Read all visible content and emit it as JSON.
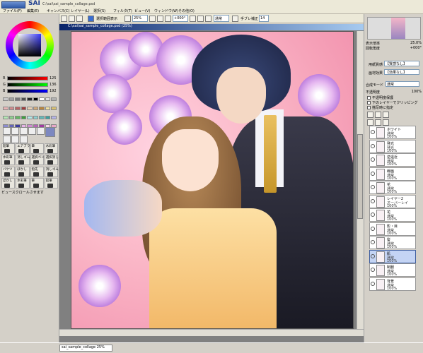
{
  "app": {
    "name": "SAI",
    "titlebar": "EasyPaint Tool SAI",
    "filename": "C:\\sai\\sai_sample_collage.psd"
  },
  "menu": [
    "ファイル(F)",
    "編集(E)",
    "キャンバス(C)",
    "レイヤー(L)",
    "選択(S)",
    "フィルタ(T)",
    "ビュー(V)",
    "ウィンドウ(W)",
    "その他(O)"
  ],
  "toolbar": {
    "show_selection": "選択範囲表示",
    "zoom": "25%",
    "rotation": "+000°",
    "blend": "通常",
    "stabilizer_label": "手ブレ補正",
    "stabilizer": "14"
  },
  "color": {
    "sliders": [
      {
        "label": "R",
        "value": "125"
      },
      {
        "label": "G",
        "value": "136"
      },
      {
        "label": "B",
        "value": "192"
      }
    ],
    "accent": "#7d88c0",
    "swatches": [
      "#c8c8c8",
      "#a0a0a0",
      "#787878",
      "#505050",
      "#282828",
      "#000000",
      "#ffffff",
      "#e0e0e0",
      "#b0b0b0",
      "#e8b4b4",
      "#d08c8c",
      "#b86464",
      "#a03c3c",
      "#e8d0b4",
      "#d0a878",
      "#b8843c",
      "#f0e0a0",
      "#d8c070",
      "#b4e8b4",
      "#8cd08c",
      "#64b864",
      "#3ca03c",
      "#b4e8e8",
      "#8cd0d0",
      "#64b8b8",
      "#3ca0a0",
      "#b4b4e8",
      "#8c8cd0",
      "#6464b8",
      "#3c3ca0",
      "#e8b4e8",
      "#d08cd0",
      "#b864b8",
      "#a03ca0",
      "#f8d8e8",
      "#e8a8c8"
    ]
  },
  "brushes": [
    {
      "label": "鉛筆"
    },
    {
      "label": "エアブラシ"
    },
    {
      "label": "筆"
    },
    {
      "label": "水彩筆"
    },
    {
      "label": "水彩筆"
    },
    {
      "label": "消しゴム"
    },
    {
      "label": "選択ペン"
    },
    {
      "label": "選択消し"
    },
    {
      "label": "バケツ"
    },
    {
      "label": "ぼかし"
    },
    {
      "label": "指先"
    },
    {
      "label": "消しゴム"
    },
    {
      "label": "ぼかし"
    },
    {
      "label": "水彩筆"
    },
    {
      "label": "筆"
    },
    {
      "label": "鉛筆"
    }
  ],
  "left_status": "ビュースクロールさせます",
  "canvas": {
    "title": "C:\\sai\\sai_sample_collage.psd (25%)"
  },
  "right": {
    "zoom_label": "表示倍率",
    "zoom_value": "25.0%",
    "angle_label": "回転角度",
    "angle_value": "+000°",
    "paper_texture_label": "用紙質感",
    "paper_texture": "【質感なし】",
    "paper_effect_label": "画材効果",
    "paper_effect": "【効果なし】",
    "blend_label": "合成モード",
    "blend": "通常",
    "opacity_label": "不透明度",
    "opacity": "100%",
    "checks": [
      "不透明度保護",
      "下のレイヤーでクリッピング",
      "描写時に指定"
    ],
    "layers": [
      {
        "name": "ホワイト",
        "mode": "通常",
        "opacity": "100%",
        "selected": false
      },
      {
        "name": "発光",
        "mode": "発光",
        "opacity": "100%",
        "selected": false
      },
      {
        "name": "逆遠近",
        "mode": "通常",
        "opacity": "100%",
        "selected": false
      },
      {
        "name": "線画",
        "mode": "通常",
        "opacity": "100%",
        "selected": false
      },
      {
        "name": "花",
        "mode": "通常",
        "opacity": "100%",
        "selected": false
      },
      {
        "name": "レイヤー2",
        "mode": "オーバーレイ",
        "opacity": "100%",
        "selected": false
      },
      {
        "name": "花",
        "mode": "通常",
        "opacity": "100%",
        "selected": false
      },
      {
        "name": "影・目",
        "mode": "通常",
        "opacity": "100%",
        "selected": false
      },
      {
        "name": "髪",
        "mode": "通常",
        "opacity": "100%",
        "selected": false
      },
      {
        "name": "肌",
        "mode": "通常",
        "opacity": "100%",
        "selected": true
      },
      {
        "name": "制服",
        "mode": "通常",
        "opacity": "100%",
        "selected": false
      },
      {
        "name": "背景",
        "mode": "通常",
        "opacity": "100%",
        "selected": false
      }
    ]
  },
  "taskbar": {
    "item": "sai_sample_collage 25%"
  }
}
